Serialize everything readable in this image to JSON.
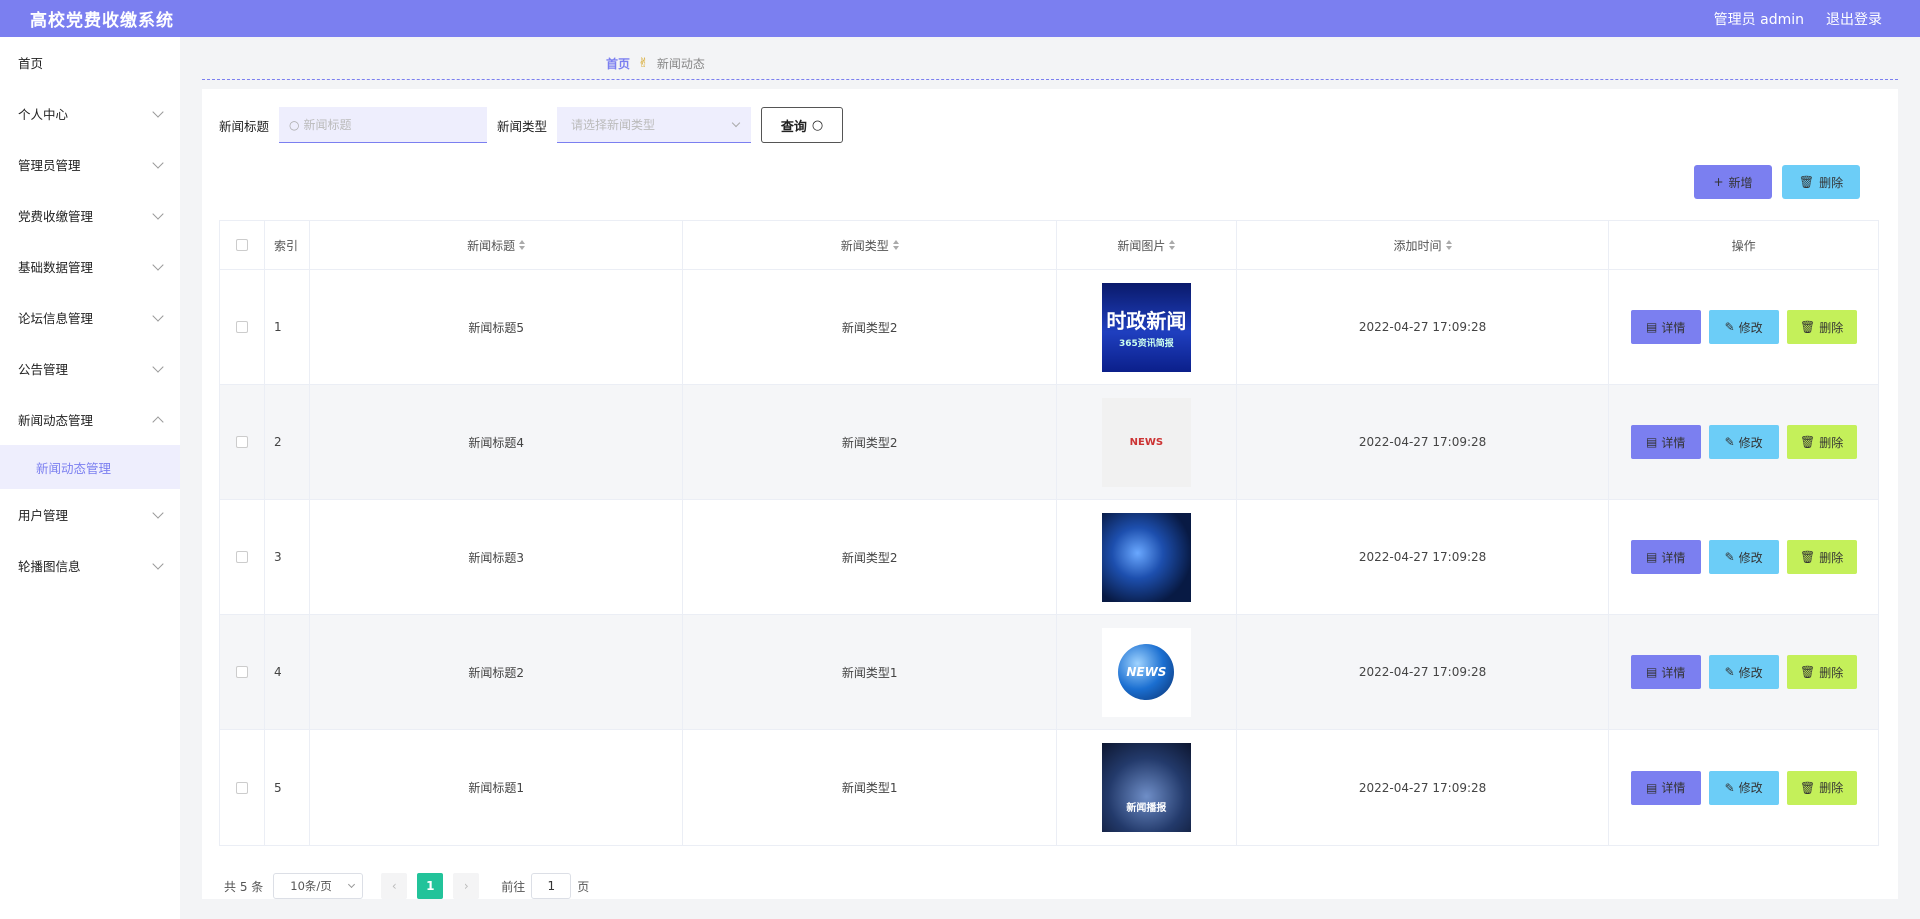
{
  "header": {
    "title": "高校党费收缴系统",
    "admin_label": "管理员 admin",
    "logout": "退出登录"
  },
  "sidebar": {
    "items": [
      {
        "label": "首页",
        "expandable": false
      },
      {
        "label": "个人中心",
        "expandable": true
      },
      {
        "label": "管理员管理",
        "expandable": true
      },
      {
        "label": "党费收缴管理",
        "expandable": true
      },
      {
        "label": "基础数据管理",
        "expandable": true
      },
      {
        "label": "论坛信息管理",
        "expandable": true
      },
      {
        "label": "公告管理",
        "expandable": true
      },
      {
        "label": "新闻动态管理",
        "expandable": true,
        "expanded": true
      },
      {
        "label": "用户管理",
        "expandable": true
      },
      {
        "label": "轮播图信息",
        "expandable": true
      }
    ],
    "subitem": "新闻动态管理"
  },
  "breadcrumb": {
    "home": "首页",
    "current": "新闻动态"
  },
  "search": {
    "title_label": "新闻标题",
    "title_placeholder": "新闻标题",
    "type_label": "新闻类型",
    "type_placeholder": "请选择新闻类型",
    "query_button": "查询"
  },
  "actions": {
    "add": "新增",
    "delete": "删除"
  },
  "table": {
    "headers": {
      "index": "索引",
      "title": "新闻标题",
      "type": "新闻类型",
      "image": "新闻图片",
      "time": "添加时间",
      "ops": "操作"
    },
    "rows": [
      {
        "index": "1",
        "title": "新闻标题5",
        "type": "新闻类型2",
        "image_text": "时政新闻",
        "image_sub": "365资讯简报",
        "time": "2022-04-27 17:09:28"
      },
      {
        "index": "2",
        "title": "新闻标题4",
        "type": "新闻类型2",
        "image_text": "NEWS",
        "image_sub": "",
        "time": "2022-04-27 17:09:28"
      },
      {
        "index": "3",
        "title": "新闻标题3",
        "type": "新闻类型2",
        "image_text": "",
        "image_sub": "",
        "time": "2022-04-27 17:09:28"
      },
      {
        "index": "4",
        "title": "新闻标题2",
        "type": "新闻类型1",
        "image_text": "NEWS",
        "image_sub": "",
        "time": "2022-04-27 17:09:28"
      },
      {
        "index": "5",
        "title": "新闻标题1",
        "type": "新闻类型1",
        "image_text": "新闻播报",
        "image_sub": "",
        "time": "2022-04-27 17:09:28"
      }
    ],
    "ops": {
      "detail": "详情",
      "edit": "修改",
      "delete": "删除"
    }
  },
  "pagination": {
    "total": "共 5 条",
    "page_size": "10条/页",
    "current_page": "1",
    "goto_label": "前往",
    "goto_value": "1",
    "page_suffix": "页"
  },
  "colors": {
    "primary": "#7b7ff0",
    "info": "#6ccdf7",
    "lime": "#c4f05a",
    "active_page": "#22c39a"
  }
}
